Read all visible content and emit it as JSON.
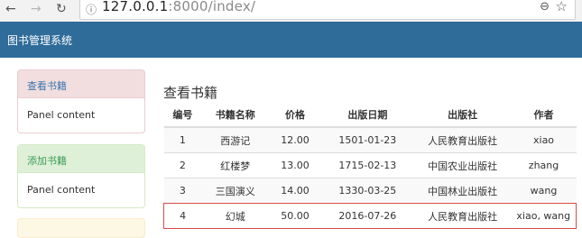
{
  "browser": {
    "url_host": "127.0.0.1",
    "url_rest": ":8000/index/"
  },
  "navbar": {
    "brand": "图书管理系统"
  },
  "sidebar": {
    "panels": [
      {
        "heading": "查看书籍",
        "body": "Panel content",
        "style": "danger"
      },
      {
        "heading": "添加书籍",
        "body": "Panel content",
        "style": "success"
      }
    ]
  },
  "main": {
    "title": "查看书籍",
    "table": {
      "headers": [
        "编号",
        "书籍名称",
        "价格",
        "出版日期",
        "出版社",
        "作者"
      ],
      "rows": [
        [
          "1",
          "西游记",
          "12.00",
          "1501-01-23",
          "人民教育出版社",
          "xiao"
        ],
        [
          "2",
          "红楼梦",
          "13.00",
          "1715-02-13",
          "中国农业出版社",
          "zhang"
        ],
        [
          "3",
          "三国演义",
          "14.00",
          "1330-03-25",
          "中国林业出版社",
          "wang"
        ],
        [
          "4",
          "幻城",
          "50.00",
          "2016-07-26",
          "人民教育出版社",
          "xiao, wang"
        ]
      ]
    }
  },
  "colors": {
    "navbar": "#2f6c9a",
    "highlight_border": "#d94a4a"
  }
}
